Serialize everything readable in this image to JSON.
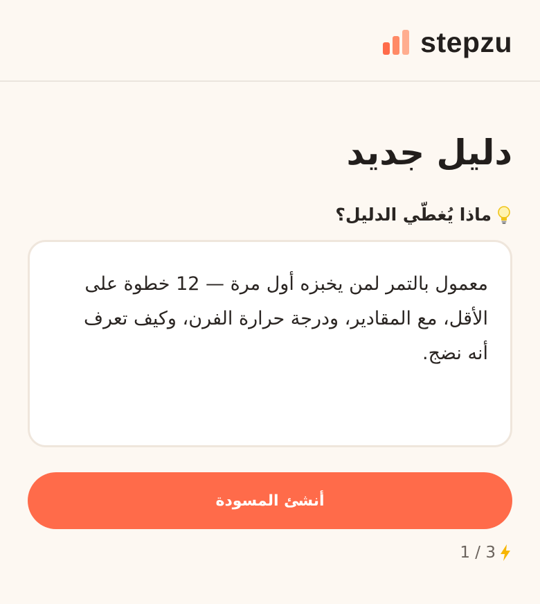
{
  "app": {
    "brand_name": "stepzu",
    "accent_color": "#ff6b4a",
    "logo_icon": "bar-chart-logo-icon"
  },
  "main": {
    "title": "دليل جديد",
    "prompt_label": "ماذا يُغطّي الدليل؟",
    "prompt_icon": "lightbulb-icon",
    "prompt_value": "معمول بالتمر لمن يخبزه أول مرة — 12 خطوة على الأقل، مع المقادير، ودرجة حرارة الفرن، وكيف تعرف أنه نضج.",
    "submit_label": "أنشئ المسودة",
    "quota_icon": "lightning-bolt-icon",
    "quota_text": "1 / 3"
  }
}
